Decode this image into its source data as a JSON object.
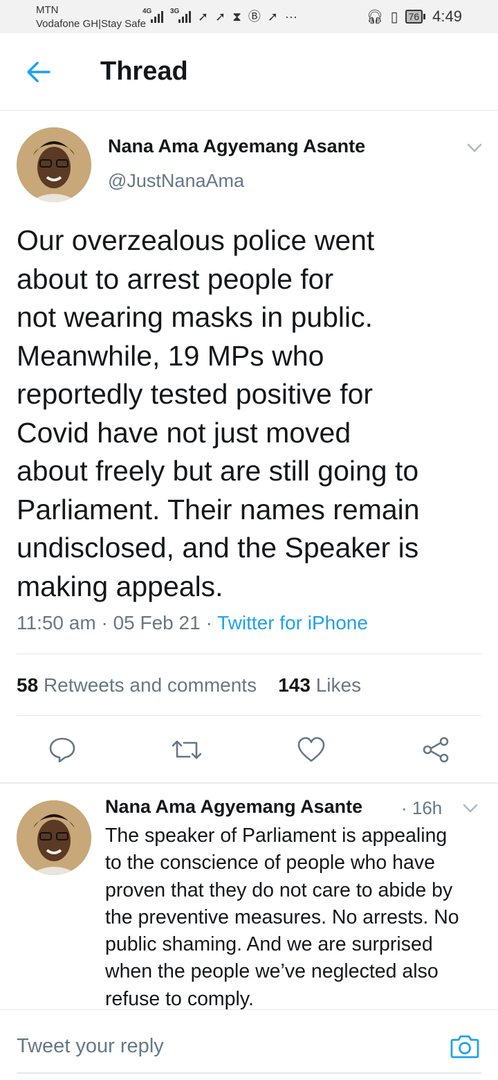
{
  "status_bar": {
    "carrier_primary": "MTN",
    "carrier_secondary": "Vodafone GH|Stay Safe",
    "network_1": "4G",
    "network_2": "3G",
    "more_indicator": "···",
    "battery_level": "76",
    "time": "4:49"
  },
  "header": {
    "title": "Thread",
    "back_icon": "arrow-left-icon"
  },
  "main_tweet": {
    "author_name": "Nana Ama Agyemang Asante",
    "author_handle": "@JustNanaAma",
    "text_lines": [
      "Our overzealous police went",
      "about to arrest people for",
      "not wearing masks in public.",
      "Meanwhile, 19 MPs who",
      "reportedly tested positive for",
      "Covid have not just moved",
      "about freely but are still going to",
      "Parliament. Their names remain",
      "undisclosed, and the Speaker is",
      "making appeals."
    ],
    "time": "11:50 am",
    "date": "05 Feb 21",
    "separator": "·",
    "source": "Twitter for iPhone",
    "retweets_count": "58",
    "retweets_label": "Retweets and comments",
    "likes_count": "143",
    "likes_label": "Likes",
    "actions": [
      "reply-icon",
      "retweet-icon",
      "like-icon",
      "share-icon"
    ]
  },
  "reply_tweet": {
    "author_name": "Nana Ama Agyemang Asante",
    "time": "· 16h",
    "text_lines": [
      "The speaker of Parliament is appealing",
      "to the conscience of people who have",
      "proven that they do not care to abide by",
      "the preventive measures. No arrests. No",
      "public shaming. And we are surprised",
      "when the people we’ve neglected also",
      "refuse to comply."
    ]
  },
  "composer": {
    "placeholder": "Tweet your reply",
    "camera_icon": "camera-icon"
  },
  "colors": {
    "accent": "#1da1f2",
    "secondary_text": "#657786",
    "primary_text": "#14171a",
    "divider": "#e1e8ed"
  }
}
